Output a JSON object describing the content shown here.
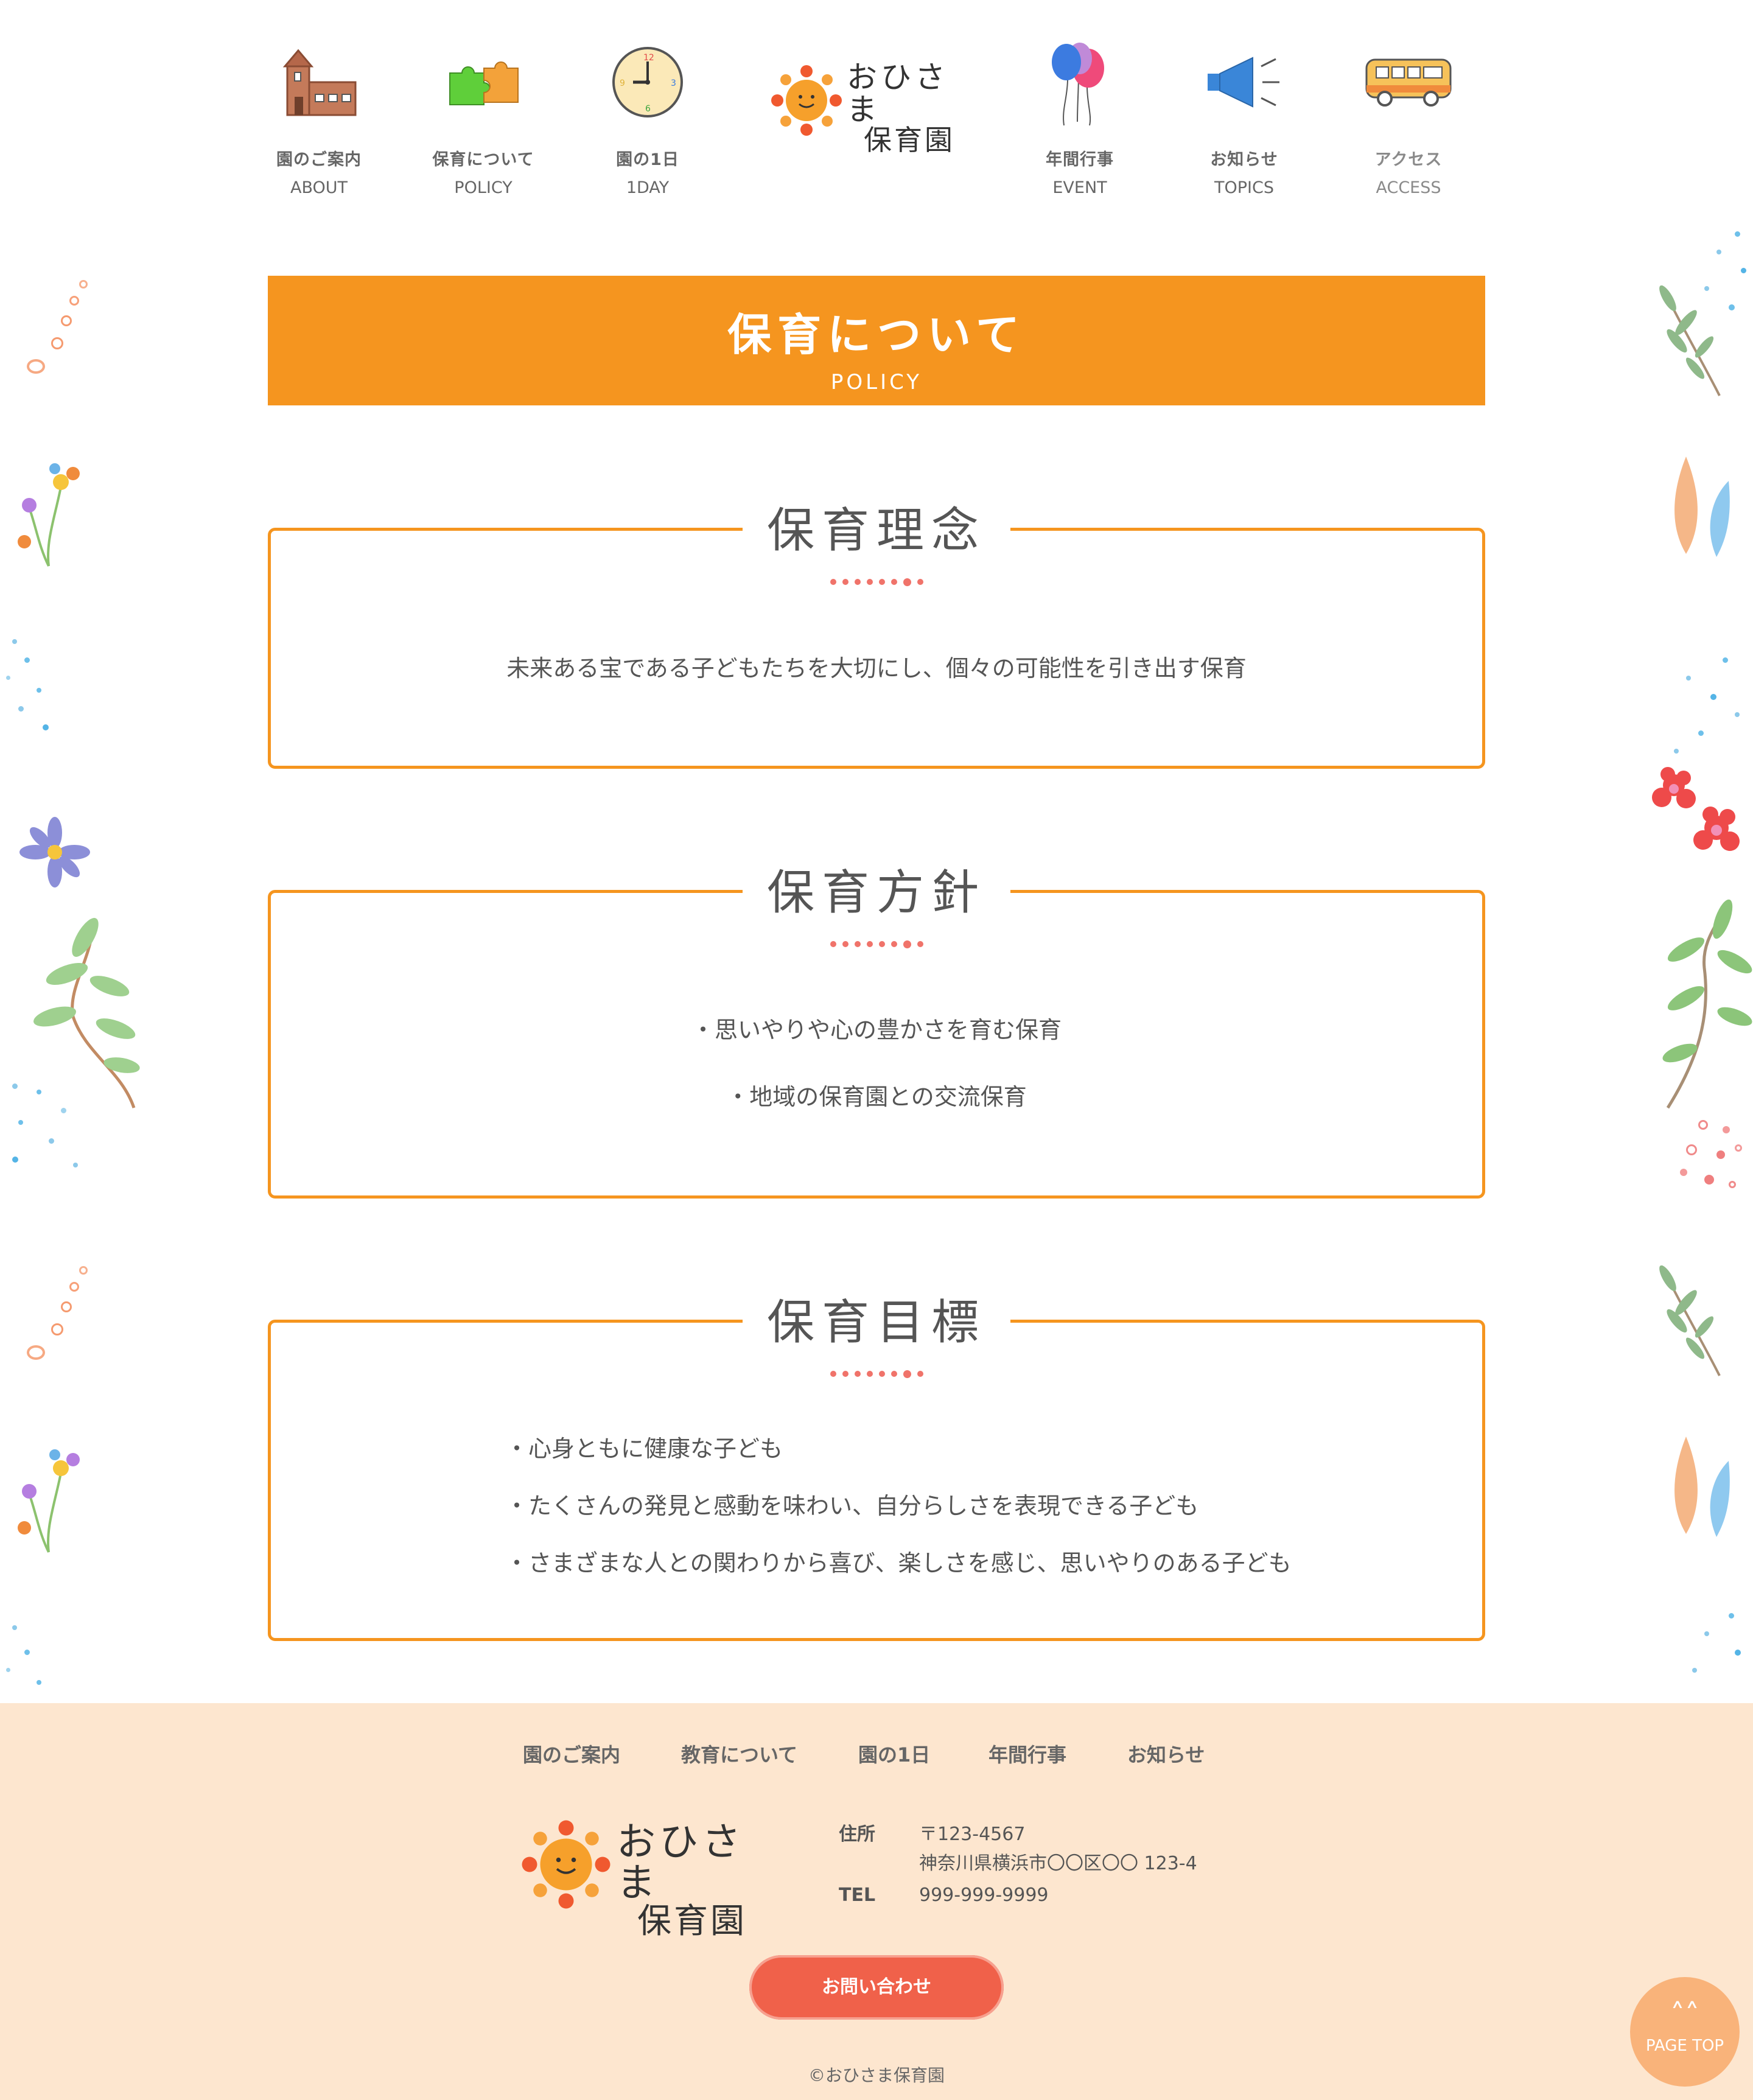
{
  "header": {
    "nav": [
      {
        "jp": "園のご案内",
        "en": "ABOUT",
        "icon": "building-icon"
      },
      {
        "jp": "保育について",
        "en": "POLICY",
        "icon": "puzzle-icon"
      },
      {
        "jp": "園の1日",
        "en": "1DAY",
        "icon": "clock-icon"
      },
      {
        "jp": "年間行事",
        "en": "EVENT",
        "icon": "balloons-icon"
      },
      {
        "jp": "お知らせ",
        "en": "TOPICS",
        "icon": "megaphone-icon"
      },
      {
        "jp": "アクセス",
        "en": "ACCESS",
        "icon": "bus-icon"
      }
    ],
    "logo": {
      "line1": "おひさま",
      "line2": "保育園"
    }
  },
  "banner": {
    "title": "保育について",
    "subtitle": "POLICY"
  },
  "sections": [
    {
      "title": "保育理念",
      "lines": [
        "未来ある宝である子どもたちを大切にし、個々の可能性を引き出す保育"
      ]
    },
    {
      "title": "保育方針",
      "lines": [
        "・思いやりや心の豊かさを育む保育",
        "・地域の保育園との交流保育"
      ]
    },
    {
      "title": "保育目標",
      "lines": [
        "・心身ともに健康な子ども",
        "・たくさんの発見と感動を味わい、自分らしさを表現できる子ども",
        "・さまざまな人との関わりから喜び、楽しさを感じ、思いやりのある子ども"
      ]
    }
  ],
  "footer": {
    "nav": [
      "園のご案内",
      "教育について",
      "園の1日",
      "年間行事",
      "お知らせ"
    ],
    "logo": {
      "line1": "おひさま",
      "line2": "保育園"
    },
    "address_label": "住所",
    "postal": "〒123-4567",
    "address": "神奈川県横浜市〇〇区〇〇 123-4",
    "tel_label": "TEL",
    "tel": "999-999-9999",
    "contact_button": "お問い合わせ",
    "copyright": "©おひさま保育園"
  },
  "page_top": {
    "label": "PAGE TOP"
  },
  "colors": {
    "accent": "#f5951f",
    "footer_bg": "#fde6cf",
    "button": "#f0614a",
    "dots": "#f0736a"
  }
}
